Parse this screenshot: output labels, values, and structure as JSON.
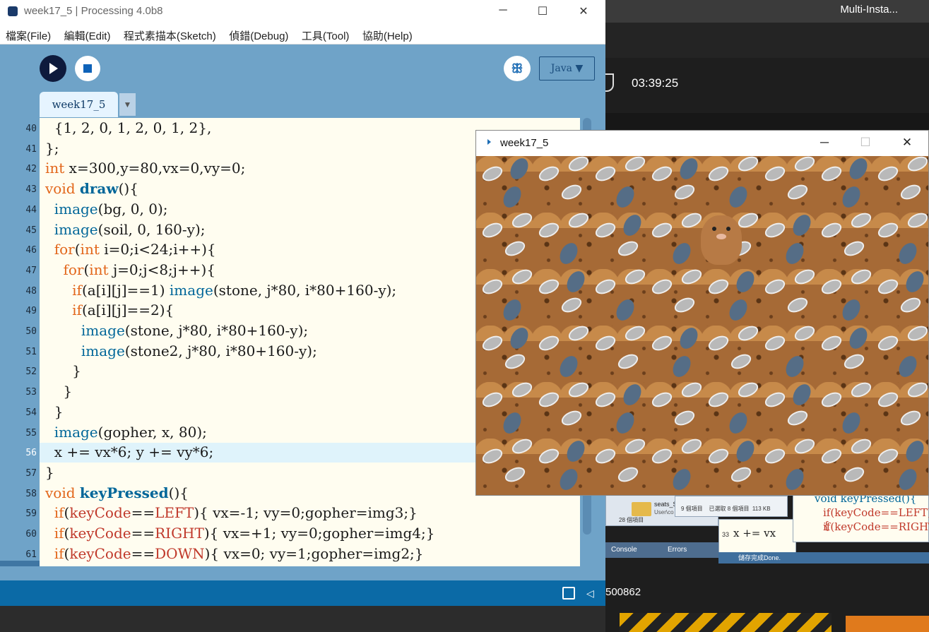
{
  "window": {
    "title": "week17_5 | Processing 4.0b8"
  },
  "menu": [
    "檔案(File)",
    "編輯(Edit)",
    "程式素描本(Sketch)",
    "偵錯(Debug)",
    "工具(Tool)",
    "協助(Help)"
  ],
  "toolbar": {
    "mode_label": "Java ▼",
    "debug_icon": "butterfly-icon"
  },
  "tab": {
    "label": "week17_5",
    "arrow": "▼"
  },
  "code": {
    "lines": [
      {
        "n": "40",
        "t": "  {1, 2, 0, 1, 2, 0, 1, 2},"
      },
      {
        "n": "41",
        "t": "};"
      },
      {
        "n": "42",
        "t": "int x=300,y=80,vx=0,vy=0;"
      },
      {
        "n": "43",
        "t": "void draw(){"
      },
      {
        "n": "44",
        "t": "  image(bg, 0, 0);"
      },
      {
        "n": "45",
        "t": "  image(soil, 0, 160-y);"
      },
      {
        "n": "46",
        "t": "  for(int i=0;i<24;i++){"
      },
      {
        "n": "47",
        "t": "    for(int j=0;j<8;j++){"
      },
      {
        "n": "48",
        "t": "      if(a[i][j]==1) image(stone, j*80, i*80+160-y);"
      },
      {
        "n": "49",
        "t": "      if(a[i][j]==2){"
      },
      {
        "n": "50",
        "t": "        image(stone, j*80, i*80+160-y);"
      },
      {
        "n": "51",
        "t": "        image(stone2, j*80, i*80+160-y);"
      },
      {
        "n": "52",
        "t": "      }"
      },
      {
        "n": "53",
        "t": "    }"
      },
      {
        "n": "54",
        "t": "  }"
      },
      {
        "n": "55",
        "t": "  image(gopher, x, 80);"
      },
      {
        "n": "56",
        "t": "  x += vx*6; y += vy*6;"
      },
      {
        "n": "57",
        "t": "}"
      },
      {
        "n": "58",
        "t": "void keyPressed(){"
      },
      {
        "n": "59",
        "t": "  if(keyCode==LEFT){ vx=-1; vy=0;gopher=img3;}"
      },
      {
        "n": "60",
        "t": "  if(keyCode==RIGHT){ vx=+1; vy=0;gopher=img4;}"
      },
      {
        "n": "61",
        "t": "  if(keyCode==DOWN){ vx=0; vy=1;gopher=img2;}"
      }
    ],
    "highlight_line": "56"
  },
  "sketch": {
    "title": "week17_5"
  },
  "background_app": {
    "title": "Multi-Insta...",
    "time": "03:39:25",
    "code_text": "500862",
    "folder_name": "seats_SS",
    "folder_path": "User\\co",
    "items_count": "28 個項目",
    "items_info": "9 個項目    已選取 8 個項目  113 KB",
    "console_tab": "Console",
    "errors_tab": "Errors",
    "saved_text": "儲存完成Done."
  },
  "colors": {
    "accent": "#6fa3c8",
    "editor_bg": "#fffdf0",
    "keyword": "#e2661a",
    "function": "#006699"
  }
}
